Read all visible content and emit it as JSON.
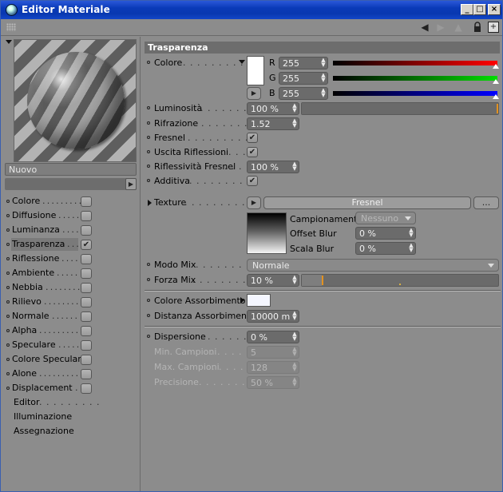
{
  "window": {
    "title": "Editor Materiale",
    "minimize": "_",
    "maximize": "□",
    "close": "×"
  },
  "toolbar": {
    "icons": [
      "back-arrow-icon",
      "forward-arrow-icon",
      "up-arrow-icon",
      "lock-icon",
      "new-panel-icon"
    ]
  },
  "preview": {
    "material_name": "Nuovo"
  },
  "channels": [
    {
      "label": "Colore",
      "checked": false
    },
    {
      "label": "Diffusione",
      "checked": false
    },
    {
      "label": "Luminanza",
      "checked": false
    },
    {
      "label": "Trasparenza",
      "checked": true,
      "selected": true
    },
    {
      "label": "Riflessione",
      "checked": false
    },
    {
      "label": "Ambiente",
      "checked": false
    },
    {
      "label": "Nebbia",
      "checked": false
    },
    {
      "label": "Rilievo",
      "checked": false
    },
    {
      "label": "Normale",
      "checked": false
    },
    {
      "label": "Alpha",
      "checked": false
    },
    {
      "label": "Speculare",
      "checked": false
    },
    {
      "label": "Colore Speculare",
      "checked": false
    },
    {
      "label": "Alone",
      "checked": false
    },
    {
      "label": "Displacement",
      "checked": false
    }
  ],
  "extra_items": [
    "Editor",
    "Illuminazione",
    "Assegnazione"
  ],
  "section_title": "Trasparenza",
  "color": {
    "label": "Colore",
    "swatch": "#ffffff",
    "r_label": "R",
    "r_value": "255",
    "g_label": "G",
    "g_value": "255",
    "b_label": "B",
    "b_value": "255",
    "r_color": "#ff0000",
    "g_color": "#00dd00",
    "b_color": "#0000ff"
  },
  "luminosity": {
    "label": "Luminosità",
    "value": "100 %",
    "fraction": 1.0
  },
  "refraction": {
    "label": "Rifrazione",
    "value": "1.52"
  },
  "fresnel": {
    "label": "Fresnel",
    "checked": true
  },
  "exit_reflections": {
    "label": "Uscita Riflessioni",
    "checked": true
  },
  "fresnel_reflectivity": {
    "label": "Riflessività Fresnel",
    "value": "100 %"
  },
  "additive": {
    "label": "Additiva",
    "checked": true
  },
  "texture": {
    "label": "Texture",
    "shader_name": "Fresnel",
    "more_button": "...",
    "sampling_label": "Campionamento",
    "sampling_value": "Nessuno",
    "offset_blur_label": "Offset Blur",
    "offset_blur_value": "0 %",
    "scale_blur_label": "Scala Blur",
    "scale_blur_value": "0 %"
  },
  "mix_mode": {
    "label": "Modo Mix",
    "value": "Normale"
  },
  "mix_strength": {
    "label": "Forza Mix",
    "value": "10 %",
    "fraction": 0.1
  },
  "absorption_color": {
    "label": "Colore Assorbimento",
    "swatch": "#f4f6ff"
  },
  "absorption_distance": {
    "label": "Distanza Assorbimento",
    "value": "10000 m"
  },
  "dispersion": {
    "label": "Dispersione",
    "value": "0 %"
  },
  "min_samples": {
    "label": "Min. Campioni",
    "value": "5"
  },
  "max_samples": {
    "label": "Max. Campioni",
    "value": "128"
  },
  "precision": {
    "label": "Precisione",
    "value": "50 %"
  }
}
